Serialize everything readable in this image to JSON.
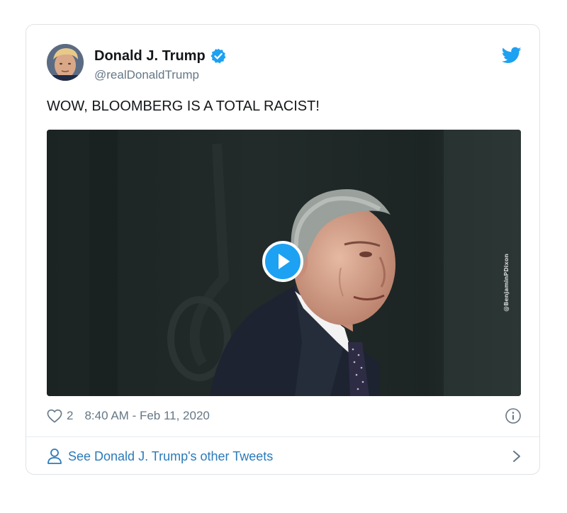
{
  "tweet": {
    "author": {
      "display_name": "Donald J. Trump",
      "handle": "@realDonaldTrump",
      "verified": true
    },
    "text": "WOW, BLOOMBERG IS A TOTAL RACIST!",
    "media": {
      "type": "video",
      "watermark": "@BenjaminPDixon"
    },
    "likes": "2",
    "timestamp": "8:40 AM - Feb 11, 2020",
    "footer_link": "See Donald J. Trump's other Tweets"
  },
  "icons": {
    "brand": "twitter-bird-icon",
    "verified": "verified-badge-icon",
    "like": "heart-icon",
    "info": "info-icon",
    "person": "person-icon",
    "chevron": "chevron-right-icon",
    "play": "play-icon"
  },
  "colors": {
    "brand_blue": "#1da1f2",
    "link_blue": "#2b7bb9",
    "text_primary": "#14171a",
    "text_secondary": "#657786",
    "border": "#dfe3e6"
  }
}
